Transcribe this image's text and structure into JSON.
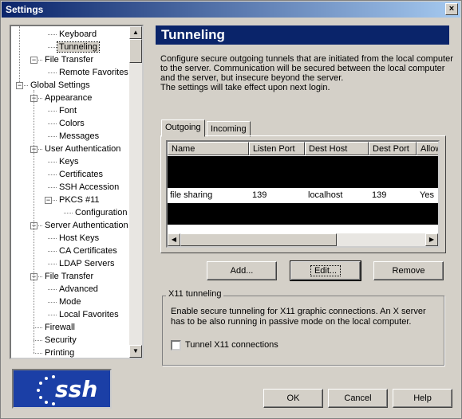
{
  "window": {
    "title": "Settings",
    "close_glyph": "×"
  },
  "tree": {
    "items": [
      {
        "label": "Keyboard",
        "level": 2
      },
      {
        "label": "Tunneling",
        "level": 2,
        "selected": true
      },
      {
        "label": "File Transfer",
        "level": 1,
        "toggle": "−"
      },
      {
        "label": "Remote Favorites",
        "level": 2
      },
      {
        "label": "Global Settings",
        "level": 0,
        "toggle": "−"
      },
      {
        "label": "Appearance",
        "level": 1,
        "toggle": "−"
      },
      {
        "label": "Font",
        "level": 2
      },
      {
        "label": "Colors",
        "level": 2
      },
      {
        "label": "Messages",
        "level": 2
      },
      {
        "label": "User Authentication",
        "level": 1,
        "toggle": "−"
      },
      {
        "label": "Keys",
        "level": 2
      },
      {
        "label": "Certificates",
        "level": 2
      },
      {
        "label": "SSH Accession",
        "level": 2
      },
      {
        "label": "PKCS #11",
        "level": 2,
        "toggle": "−"
      },
      {
        "label": "Configuration",
        "level": 3
      },
      {
        "label": "Server Authentication",
        "level": 1,
        "toggle": "−"
      },
      {
        "label": "Host Keys",
        "level": 2
      },
      {
        "label": "CA Certificates",
        "level": 2
      },
      {
        "label": "LDAP Servers",
        "level": 2
      },
      {
        "label": "File Transfer",
        "level": 1,
        "toggle": "−"
      },
      {
        "label": "Advanced",
        "level": 2
      },
      {
        "label": "Mode",
        "level": 2
      },
      {
        "label": "Local Favorites",
        "level": 2
      },
      {
        "label": "Firewall",
        "level": 1
      },
      {
        "label": "Security",
        "level": 1
      },
      {
        "label": "Printing",
        "level": 1
      }
    ],
    "scroll_up": "▲",
    "scroll_down": "▼"
  },
  "logo": {
    "text": "ssh"
  },
  "panel": {
    "title": "Tunneling",
    "description": [
      "Configure secure outgoing tunnels that are initiated from the local computer",
      "to the server. Communication will be secured between the local computer",
      "and the server, but insecure beyond the server.",
      "The settings will take effect upon next login."
    ]
  },
  "tabs": [
    {
      "label": "Outgoing",
      "active": true
    },
    {
      "label": "Incoming",
      "active": false
    }
  ],
  "table": {
    "columns": [
      "Name",
      "Listen Port",
      "Dest Host",
      "Dest Port",
      "Allow"
    ],
    "rows": [
      [
        "file sharing",
        "139",
        "localhost",
        "139",
        "Yes"
      ]
    ],
    "scroll_left": "◀",
    "scroll_right": "▶"
  },
  "buttons": {
    "add": "Add...",
    "edit": "Edit...",
    "remove": "Remove"
  },
  "x11": {
    "title": "X11 tunneling",
    "text": "Enable secure tunneling for X11 graphic connections. An X server has to be also running in passive mode on the local computer.",
    "checkbox_label": "Tunnel X11 connections",
    "checked": false
  },
  "footer": {
    "ok": "OK",
    "cancel": "Cancel",
    "help": "Help"
  }
}
